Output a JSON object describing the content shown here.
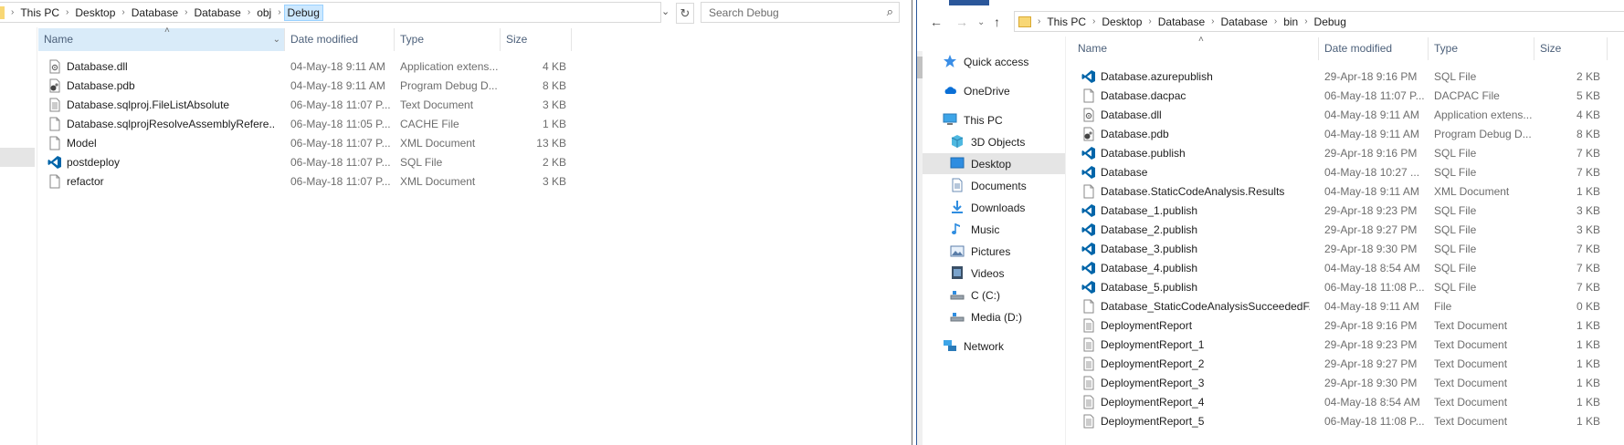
{
  "left": {
    "breadcrumb": [
      "This PC",
      "Desktop",
      "Database",
      "Database",
      "obj",
      "Debug"
    ],
    "search_placeholder": "Search Debug",
    "columns": [
      "Name",
      "Date modified",
      "Type",
      "Size"
    ],
    "files": [
      {
        "icon": "dll-file-icon",
        "name": "Database.dll",
        "date": "04-May-18 9:11 AM",
        "type": "Application extens...",
        "size": "4 KB"
      },
      {
        "icon": "pdb-file-icon",
        "name": "Database.pdb",
        "date": "04-May-18 9:11 AM",
        "type": "Program Debug D...",
        "size": "8 KB"
      },
      {
        "icon": "text-file-icon",
        "name": "Database.sqlproj.FileListAbsolute",
        "date": "06-May-18 11:07 P...",
        "type": "Text Document",
        "size": "3 KB"
      },
      {
        "icon": "blank-file-icon",
        "name": "Database.sqlprojResolveAssemblyRefere...",
        "date": "06-May-18 11:05 P...",
        "type": "CACHE File",
        "size": "1 KB"
      },
      {
        "icon": "blank-file-icon",
        "name": "Model",
        "date": "06-May-18 11:07 P...",
        "type": "XML Document",
        "size": "13 KB"
      },
      {
        "icon": "vscode-file-icon",
        "name": "postdeploy",
        "date": "06-May-18 11:07 P...",
        "type": "SQL File",
        "size": "2 KB"
      },
      {
        "icon": "blank-file-icon",
        "name": "refactor",
        "date": "06-May-18 11:07 P...",
        "type": "XML Document",
        "size": "3 KB"
      }
    ]
  },
  "right": {
    "breadcrumb": [
      "This PC",
      "Desktop",
      "Database",
      "Database",
      "bin",
      "Debug"
    ],
    "columns": [
      "Name",
      "Date modified",
      "Type",
      "Size"
    ],
    "nav": [
      {
        "icon": "star-icon",
        "label": "Quick access",
        "indent": 0
      },
      {
        "icon": "onedrive-icon",
        "label": "OneDrive",
        "indent": 0
      },
      {
        "icon": "computer-icon",
        "label": "This PC",
        "indent": 0
      },
      {
        "icon": "3d-objects-icon",
        "label": "3D Objects",
        "indent": 1
      },
      {
        "icon": "desktop-icon",
        "label": "Desktop",
        "indent": 1
      },
      {
        "icon": "documents-icon",
        "label": "Documents",
        "indent": 1
      },
      {
        "icon": "downloads-icon",
        "label": "Downloads",
        "indent": 1
      },
      {
        "icon": "music-icon",
        "label": "Music",
        "indent": 1
      },
      {
        "icon": "pictures-icon",
        "label": "Pictures",
        "indent": 1
      },
      {
        "icon": "videos-icon",
        "label": "Videos",
        "indent": 1
      },
      {
        "icon": "drive-icon",
        "label": "C (C:)",
        "indent": 1
      },
      {
        "icon": "drive-icon",
        "label": "Media (D:)",
        "indent": 1
      },
      {
        "icon": "network-icon",
        "label": "Network",
        "indent": 0
      }
    ],
    "selected_nav": "Desktop",
    "files": [
      {
        "icon": "vscode-file-icon",
        "name": "Database.azurepublish",
        "date": "29-Apr-18 9:16 PM",
        "type": "SQL File",
        "size": "2 KB"
      },
      {
        "icon": "blank-file-icon",
        "name": "Database.dacpac",
        "date": "06-May-18 11:07 P...",
        "type": "DACPAC File",
        "size": "5 KB"
      },
      {
        "icon": "dll-file-icon",
        "name": "Database.dll",
        "date": "04-May-18 9:11 AM",
        "type": "Application extens...",
        "size": "4 KB"
      },
      {
        "icon": "pdb-file-icon",
        "name": "Database.pdb",
        "date": "04-May-18 9:11 AM",
        "type": "Program Debug D...",
        "size": "8 KB"
      },
      {
        "icon": "vscode-file-icon",
        "name": "Database.publish",
        "date": "29-Apr-18 9:16 PM",
        "type": "SQL File",
        "size": "7 KB"
      },
      {
        "icon": "vscode-file-icon",
        "name": "Database",
        "date": "04-May-18 10:27 ...",
        "type": "SQL File",
        "size": "7 KB"
      },
      {
        "icon": "blank-file-icon",
        "name": "Database.StaticCodeAnalysis.Results",
        "date": "04-May-18 9:11 AM",
        "type": "XML Document",
        "size": "1 KB"
      },
      {
        "icon": "vscode-file-icon",
        "name": "Database_1.publish",
        "date": "29-Apr-18 9:23 PM",
        "type": "SQL File",
        "size": "3 KB"
      },
      {
        "icon": "vscode-file-icon",
        "name": "Database_2.publish",
        "date": "29-Apr-18 9:27 PM",
        "type": "SQL File",
        "size": "3 KB"
      },
      {
        "icon": "vscode-file-icon",
        "name": "Database_3.publish",
        "date": "29-Apr-18 9:30 PM",
        "type": "SQL File",
        "size": "7 KB"
      },
      {
        "icon": "vscode-file-icon",
        "name": "Database_4.publish",
        "date": "04-May-18 8:54 AM",
        "type": "SQL File",
        "size": "7 KB"
      },
      {
        "icon": "vscode-file-icon",
        "name": "Database_5.publish",
        "date": "06-May-18 11:08 P...",
        "type": "SQL File",
        "size": "7 KB"
      },
      {
        "icon": "blank-file-icon",
        "name": "Database_StaticCodeAnalysisSucceededF...",
        "date": "04-May-18 9:11 AM",
        "type": "File",
        "size": "0 KB"
      },
      {
        "icon": "text-file-icon",
        "name": "DeploymentReport",
        "date": "29-Apr-18 9:16 PM",
        "type": "Text Document",
        "size": "1 KB"
      },
      {
        "icon": "text-file-icon",
        "name": "DeploymentReport_1",
        "date": "29-Apr-18 9:23 PM",
        "type": "Text Document",
        "size": "1 KB"
      },
      {
        "icon": "text-file-icon",
        "name": "DeploymentReport_2",
        "date": "29-Apr-18 9:27 PM",
        "type": "Text Document",
        "size": "1 KB"
      },
      {
        "icon": "text-file-icon",
        "name": "DeploymentReport_3",
        "date": "29-Apr-18 9:30 PM",
        "type": "Text Document",
        "size": "1 KB"
      },
      {
        "icon": "text-file-icon",
        "name": "DeploymentReport_4",
        "date": "04-May-18 8:54 AM",
        "type": "Text Document",
        "size": "1 KB"
      },
      {
        "icon": "text-file-icon",
        "name": "DeploymentReport_5",
        "date": "06-May-18 11:08 P...",
        "type": "Text Document",
        "size": "1 KB"
      }
    ]
  },
  "colors": {
    "accent": "#2b579a",
    "selection": "#cce8ff",
    "vscode_blue": "#0065a9",
    "folder_yellow": "#f8d775"
  }
}
